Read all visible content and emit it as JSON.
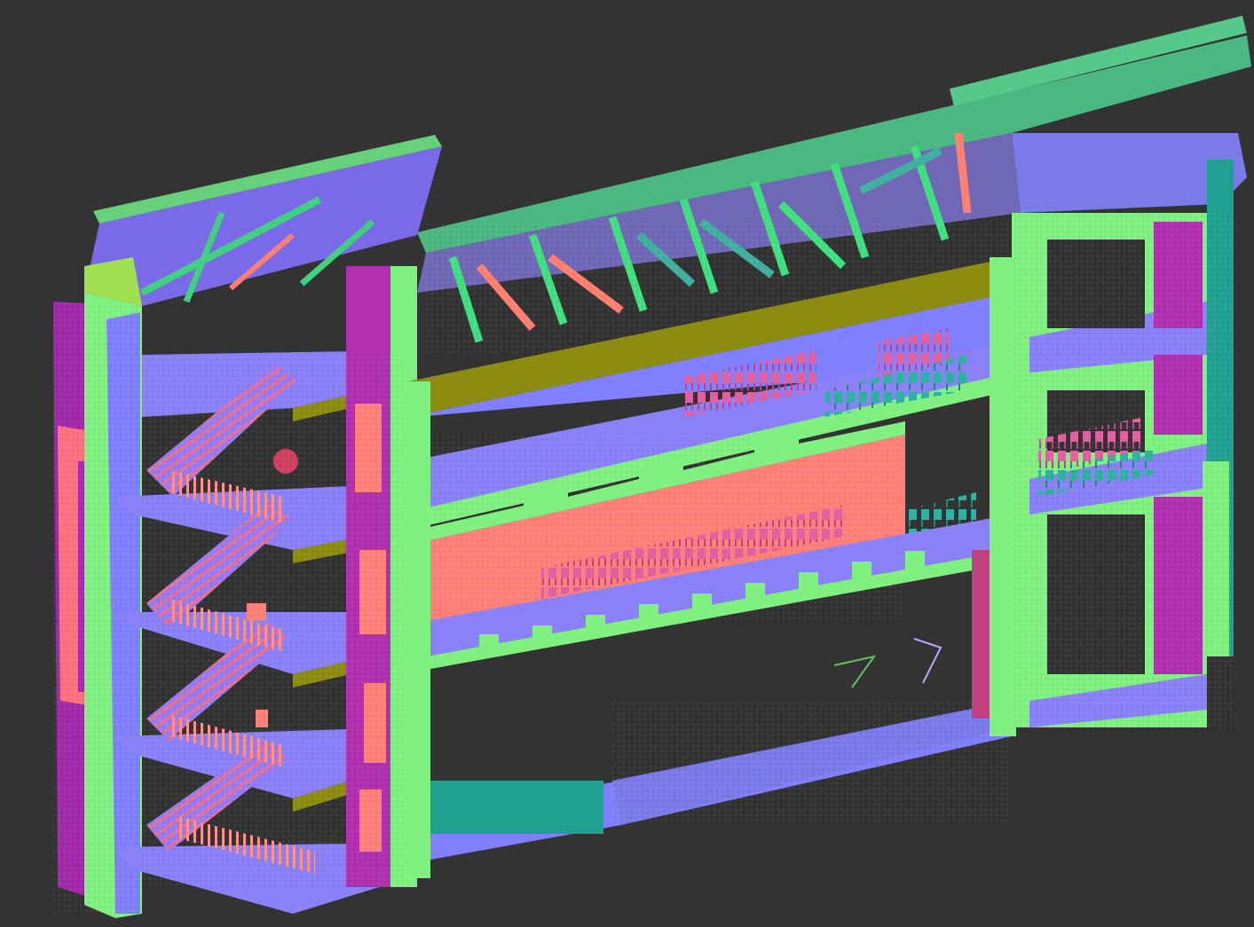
{
  "viewport": {
    "background_color": "#333333"
  },
  "scene": {
    "subject": "point-cloud-building-cross-section",
    "shading": "surface-normal-colors",
    "palette": {
      "floor_up": "#8080ff",
      "wall_magenta": "#b428b4",
      "wall_salmon": "#ff8078",
      "edge_green": "#80ff80",
      "edge_olive": "#8c8c10",
      "teal": "#20a090",
      "truss_green": "#40e080",
      "dark_magenta": "#7a1a8a"
    },
    "levels_visible": 5,
    "staircases": 4
  }
}
